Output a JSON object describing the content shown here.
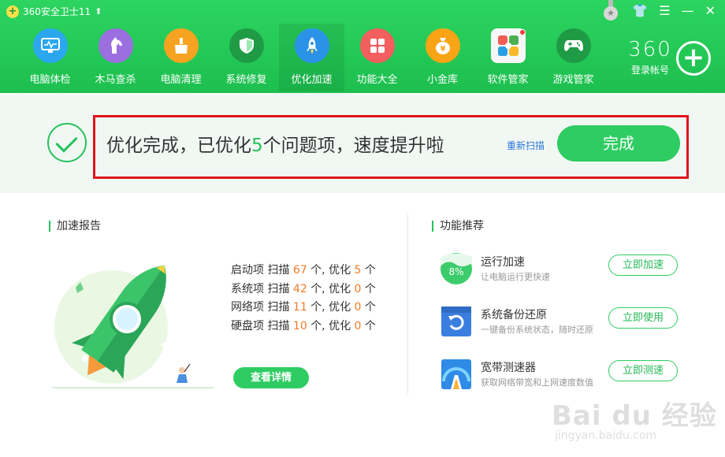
{
  "window": {
    "title": "360安全卫士11",
    "up_arrow": "⬆",
    "controls": [
      "👕",
      "☰",
      "—",
      "✕"
    ]
  },
  "nav": [
    {
      "label": "电脑体检",
      "icon": "monitor-icon",
      "color": "#2aa7ee"
    },
    {
      "label": "木马查杀",
      "icon": "horse-icon",
      "color": "#9b6fe0"
    },
    {
      "label": "电脑清理",
      "icon": "broom-icon",
      "color": "#f6a321"
    },
    {
      "label": "系统修复",
      "icon": "shield-icon",
      "color": "#1f9b45"
    },
    {
      "label": "优化加速",
      "icon": "rocket-icon",
      "color": "#2a93e8",
      "active": true
    },
    {
      "label": "功能大全",
      "icon": "grid-icon",
      "color": "#f35e5e"
    },
    {
      "label": "小金库",
      "icon": "moneybag-icon",
      "color": "#f8a414"
    },
    {
      "label": "软件管家",
      "icon": "flower-icon",
      "color": "#f1f1f1",
      "badge": true
    },
    {
      "label": "游戏管家",
      "icon": "gamepad-icon",
      "color": "#1f9b45"
    }
  ],
  "account": {
    "brand": "360",
    "login": "登录帐号"
  },
  "result": {
    "prefix": "优化完成，已优化",
    "count": "5",
    "suffix": "个问题项，速度提升啦",
    "rescan": "重新扫描",
    "done": "完成"
  },
  "report": {
    "title": "加速报告",
    "rows": [
      {
        "label": "启动项 扫描",
        "scanned": "67",
        "mid": "个, 优化",
        "optimized": "5",
        "unit": "个"
      },
      {
        "label": "系统项 扫描",
        "scanned": "42",
        "mid": "个, 优化",
        "optimized": "0",
        "unit": "个"
      },
      {
        "label": "网络项 扫描",
        "scanned": "11",
        "mid": "个, 优化",
        "optimized": "0",
        "unit": "个"
      },
      {
        "label": "硬盘项 扫描",
        "scanned": "10",
        "mid": "个, 优化",
        "optimized": "0",
        "unit": "个"
      }
    ],
    "detail_btn": "查看详情"
  },
  "features": {
    "title": "功能推荐",
    "items": [
      {
        "title": "运行加速",
        "desc": "让电脑运行更快速",
        "btn": "立即加速",
        "icon": "speed-percent-icon",
        "icon_text": "8%"
      },
      {
        "title": "系统备份还原",
        "desc": "一键备份系统状态，随时还原",
        "btn": "立即使用",
        "icon": "backup-restore-icon"
      },
      {
        "title": "宽带测速器",
        "desc": "获取网络带宽和上网速度数值",
        "btn": "立即测速",
        "icon": "speed-meter-icon"
      }
    ]
  },
  "watermark": {
    "brand": "Bai du 经验",
    "url": "jingyan.baidu.com"
  },
  "colors": {
    "header": "#1dbf4f",
    "accent": "#2ecc62",
    "orange": "#f07c2a",
    "highlight": "#e0141e",
    "link": "#2c74d8"
  }
}
